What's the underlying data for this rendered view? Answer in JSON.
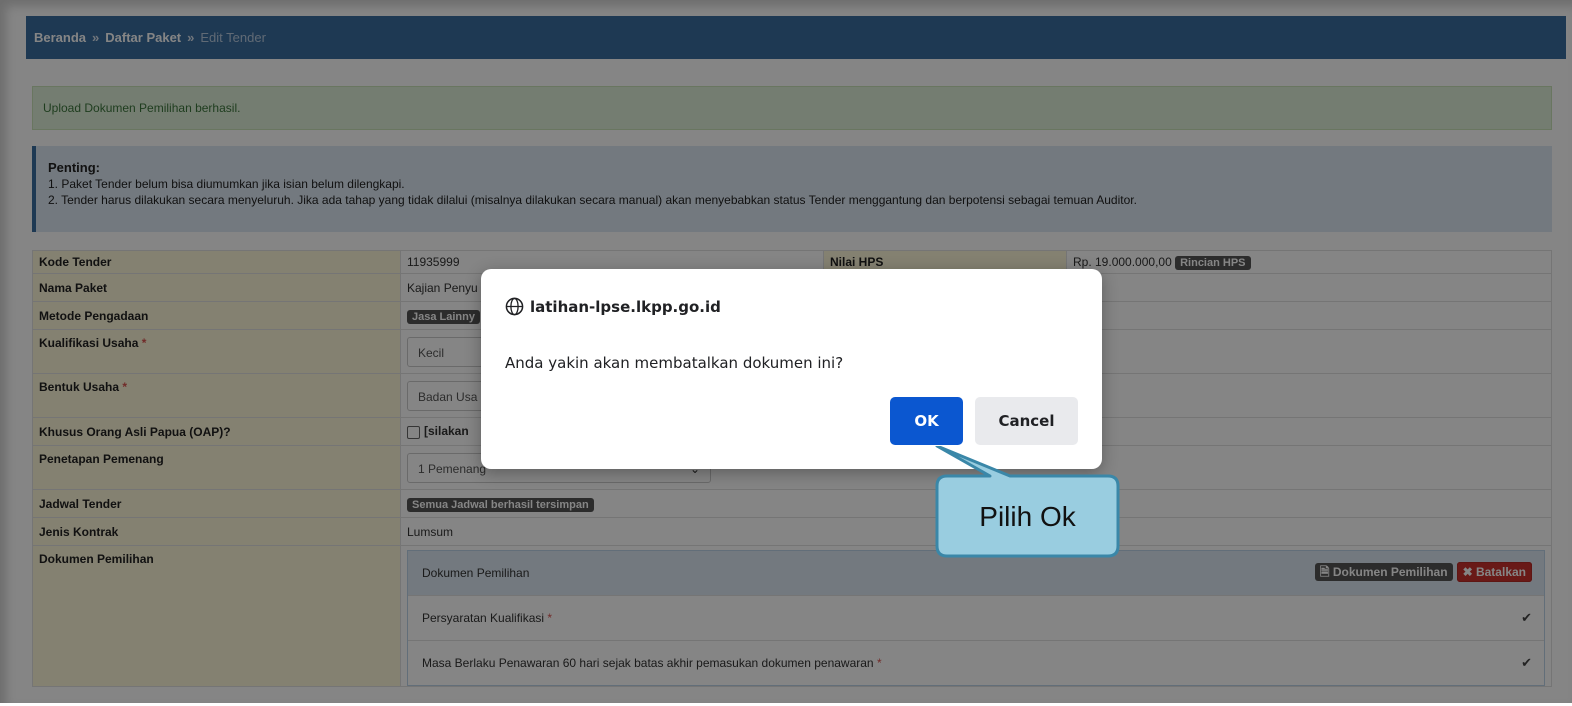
{
  "breadcrumb": {
    "home": "Beranda",
    "separator": "»",
    "list": "Daftar Paket",
    "current": "Edit Tender"
  },
  "alert_success": "Upload Dokumen Pemilihan berhasil.",
  "alert_info": {
    "title": "Penting:",
    "line1": "1. Paket Tender belum bisa diumumkan jika isian belum dilengkapi.",
    "line2": "2. Tender harus dilakukan secara menyeluruh. Jika ada tahap yang tidak dilalui (misalnya dilakukan secara manual) akan menyebabkan status Tender menggantung dan berpotensi sebagai temuan Auditor."
  },
  "form": {
    "kode_label": "Kode Tender",
    "kode_value": "11935999",
    "nilai_label": "Nilai HPS",
    "nilai_value": "Rp. 19.000.000,00",
    "rincian_btn": "Rincian HPS",
    "nama_label": "Nama Paket",
    "nama_value": "Kajian Penyu",
    "metode_label": "Metode Pengadaan",
    "metode_value": "Jasa Lainny",
    "kualifikasi_label": "Kualifikasi Usaha",
    "kualifikasi_value": "Kecil",
    "bentuk_label": "Bentuk Usaha",
    "bentuk_value": "Badan Usa",
    "oap_label": "Khusus Orang Asli Papua (OAP)?",
    "oap_value": "[silakan",
    "penetapan_label": "Penetapan Pemenang",
    "penetapan_value": "1 Pemenang",
    "jadwal_label": "Jadwal Tender",
    "jadwal_value": "Semua Jadwal berhasil tersimpan",
    "jenis_label": "Jenis Kontrak",
    "jenis_value": "Lumsum",
    "dokumen_label": "Dokumen Pemilihan",
    "required_mark": "*"
  },
  "panel": {
    "title": "Dokumen Pemilihan",
    "doc_btn": "Dokumen Pemilihan",
    "batal_btn": "Batalkan",
    "row1": "Persyaratan Kualifikasi",
    "row2": "Masa Berlaku Penawaran 60 hari sejak batas akhir pemasukan dokumen penawaran"
  },
  "dialog": {
    "origin": "latihan-lpse.lkpp.go.id",
    "message": "Anda yakin akan membatalkan dokumen ini?",
    "ok": "OK",
    "cancel": "Cancel"
  },
  "callout": {
    "text": "Pilih Ok"
  },
  "colors": {
    "header": "#3b6e9f",
    "ok_button": "#0b57d0",
    "callout_fill": "#99cde0",
    "callout_border": "#3a87a8"
  }
}
